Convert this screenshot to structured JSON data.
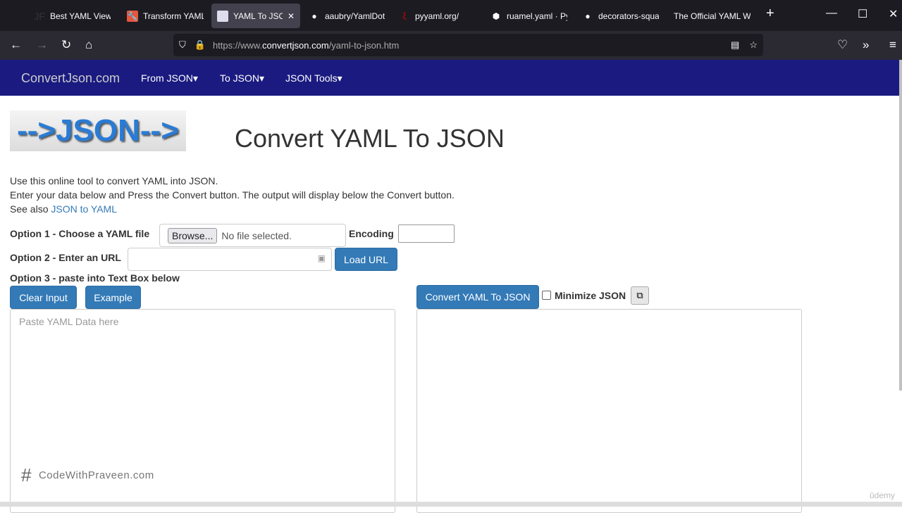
{
  "browser": {
    "tabs": [
      {
        "title": "Best YAML Viewe",
        "icon": "jf-icon"
      },
      {
        "title": "Transform YAML",
        "icon": "wrench-icon"
      },
      {
        "title": "YAML To JSON",
        "icon": "page-icon",
        "active": true
      },
      {
        "title": "aaubry/YamlDot",
        "icon": "github-icon"
      },
      {
        "title": "pyyaml.org/",
        "icon": "xi-icon"
      },
      {
        "title": "ruamel.yaml · Py",
        "icon": "box-icon"
      },
      {
        "title": "decorators-squa",
        "icon": "github-icon"
      },
      {
        "title": "The Official YAML W",
        "icon": ""
      }
    ],
    "url_prefix": "https://www.",
    "url_domain": "convertjson.com",
    "url_path": "/yaml-to-json.htm"
  },
  "site": {
    "brand": "ConvertJson.com",
    "menu": [
      "From JSON",
      "To JSON",
      "JSON Tools"
    ],
    "logo_text": "-->JSON-->",
    "title": "Convert YAML To JSON",
    "intro1": "Use this online tool to convert YAML into JSON.",
    "intro2": "Enter your data below and Press the Convert button. The output will display below the Convert button.",
    "see_also": "See also ",
    "see_also_link": "JSON to YAML",
    "opt1": "Option 1 - Choose a YAML file",
    "browse": "Browse...",
    "no_file": "No file selected.",
    "encoding": "Encoding",
    "opt2": "Option 2 - Enter an URL",
    "load_url": "Load URL",
    "opt3": "Option 3 - paste into Text Box below",
    "clear": "Clear Input",
    "example": "Example",
    "input_placeholder": "Paste YAML Data here",
    "convert": "Convert YAML To JSON",
    "minimize": "Minimize JSON"
  },
  "watermark": "CodeWithPraveen.com",
  "udemy": "ûdemy"
}
